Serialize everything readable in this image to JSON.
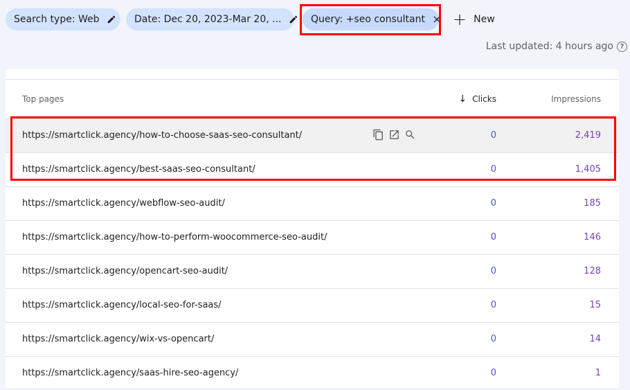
{
  "filters": {
    "search_type": "Search type: Web",
    "date": "Date: Dec 20, 2023-Mar 20, ...",
    "query": "Query: +seo consultant",
    "new_label": "New"
  },
  "status": {
    "last_updated": "Last updated: 4 hours ago"
  },
  "table": {
    "headers": {
      "pages": "Top pages",
      "clicks": "Clicks",
      "impressions": "Impressions"
    },
    "rows": [
      {
        "url": "https://smartclick.agency/how-to-choose-saas-seo-consultant/",
        "clicks": "0",
        "impressions": "2,419"
      },
      {
        "url": "https://smartclick.agency/best-saas-seo-consultant/",
        "clicks": "0",
        "impressions": "1,405"
      },
      {
        "url": "https://smartclick.agency/webflow-seo-audit/",
        "clicks": "0",
        "impressions": "185"
      },
      {
        "url": "https://smartclick.agency/how-to-perform-woocommerce-seo-audit/",
        "clicks": "0",
        "impressions": "146"
      },
      {
        "url": "https://smartclick.agency/opencart-seo-audit/",
        "clicks": "0",
        "impressions": "128"
      },
      {
        "url": "https://smartclick.agency/local-seo-for-saas/",
        "clicks": "0",
        "impressions": "15"
      },
      {
        "url": "https://smartclick.agency/wix-vs-opencart/",
        "clicks": "0",
        "impressions": "14"
      },
      {
        "url": "https://smartclick.agency/saas-hire-seo-agency/",
        "clicks": "0",
        "impressions": "1"
      }
    ]
  },
  "icons": {
    "edit": "pencil-icon",
    "close": "close-icon",
    "copy": "copy-icon",
    "open": "open-in-new-icon",
    "inspect": "search-icon",
    "help": "help-icon",
    "sort": "arrow-down-icon"
  },
  "colors": {
    "chip_bg": "#d3e3fd",
    "clicks": "#4b55c7",
    "impressions": "#7b3fb8",
    "highlight": "#ff0000"
  }
}
